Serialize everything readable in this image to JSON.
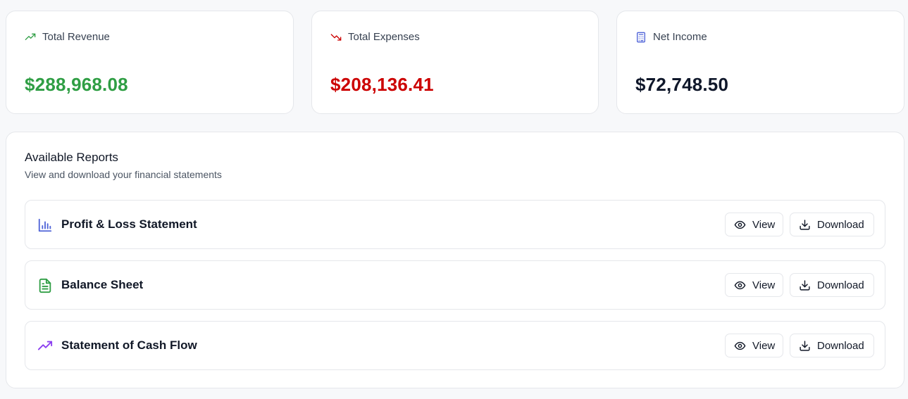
{
  "stats": {
    "revenue": {
      "label": "Total Revenue",
      "value": "$288,968.08",
      "color": "#2f9e44",
      "icon": "trending-up-icon"
    },
    "expenses": {
      "label": "Total Expenses",
      "value": "$208,136.41",
      "color": "#cc0000",
      "icon": "trending-down-icon"
    },
    "net_income": {
      "label": "Net Income",
      "value": "$72,748.50",
      "color": "#0f172a",
      "icon": "calculator-icon"
    }
  },
  "reports": {
    "title": "Available Reports",
    "subtitle": "View and download your financial statements",
    "items": [
      {
        "name": "Profit & Loss Statement",
        "icon": "bar-chart-icon",
        "icon_color": "#4f63d8",
        "view_label": "View",
        "download_label": "Download"
      },
      {
        "name": "Balance Sheet",
        "icon": "file-text-icon",
        "icon_color": "#2f9e44",
        "view_label": "View",
        "download_label": "Download"
      },
      {
        "name": "Statement of Cash Flow",
        "icon": "trending-up-icon",
        "icon_color": "#8b3ff0",
        "view_label": "View",
        "download_label": "Download"
      }
    ]
  }
}
